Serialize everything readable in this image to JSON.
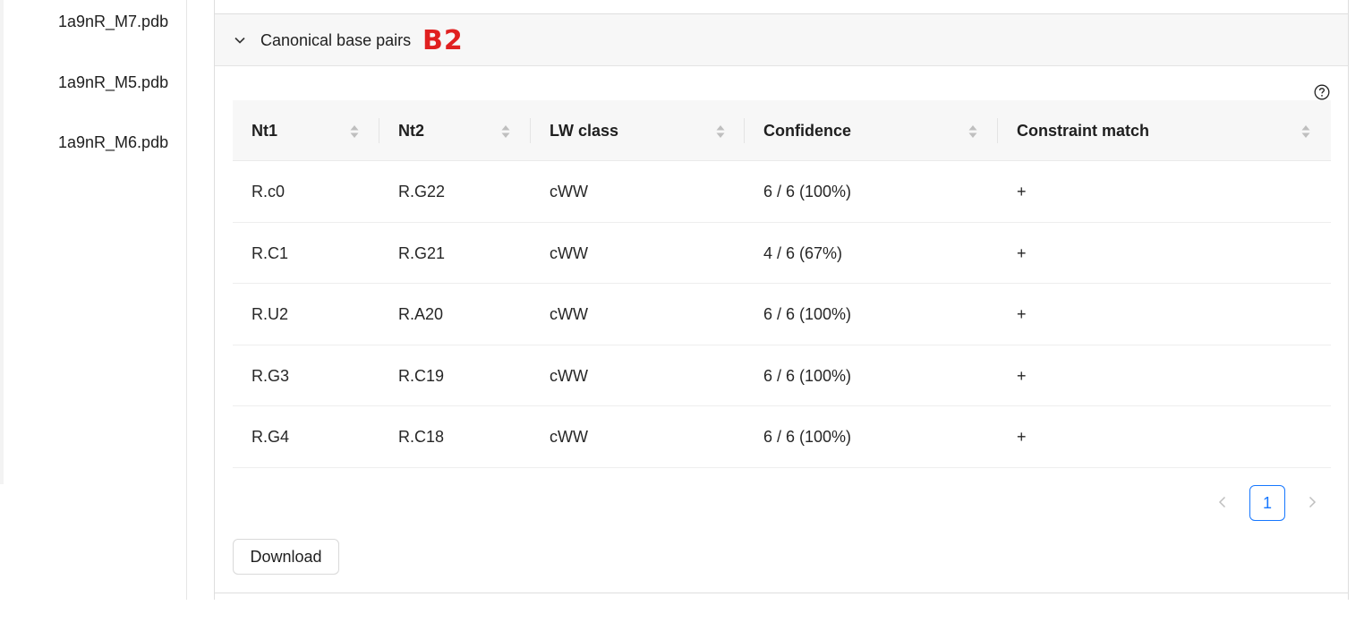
{
  "sidebar": {
    "files": [
      "1a9nR_M7.pdb",
      "1a9nR_M5.pdb",
      "1a9nR_M6.pdb"
    ]
  },
  "section": {
    "title": "Canonical base pairs",
    "tag": "B2"
  },
  "table": {
    "columns": [
      "Nt1",
      "Nt2",
      "LW class",
      "Confidence",
      "Constraint match"
    ],
    "rows": [
      [
        "R.c0",
        "R.G22",
        "cWW",
        "6 / 6 (100%)",
        "+"
      ],
      [
        "R.C1",
        "R.G21",
        "cWW",
        "4 / 6 (67%)",
        "+"
      ],
      [
        "R.U2",
        "R.A20",
        "cWW",
        "6 / 6 (100%)",
        "+"
      ],
      [
        "R.G3",
        "R.C19",
        "cWW",
        "6 / 6 (100%)",
        "+"
      ],
      [
        "R.G4",
        "R.C18",
        "cWW",
        "6 / 6 (100%)",
        "+"
      ]
    ]
  },
  "pagination": {
    "current_page": "1"
  },
  "actions": {
    "download_label": "Download"
  },
  "colors": {
    "accent": "#1677ff",
    "tag": "#e02020"
  },
  "icons": {
    "collapse": "chevron-down-icon",
    "help": "question-circle-icon",
    "sort": "sort-icon"
  }
}
